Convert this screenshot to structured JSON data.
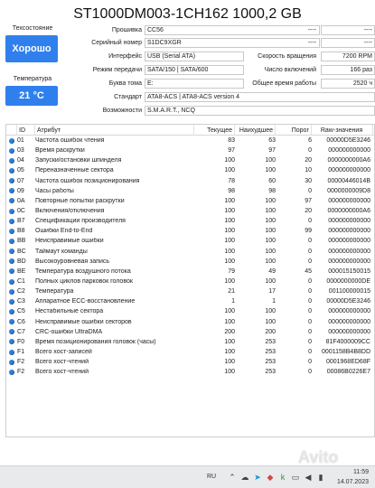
{
  "window": {
    "title": "ST1000DM003-1CH162 1000,2 GB"
  },
  "health": {
    "label": "Техсостояние",
    "value": "Хорошо",
    "color": "#2f80ed"
  },
  "temperature": {
    "label": "Температура",
    "value": "21 °C"
  },
  "info": {
    "firmware_label": "Прошивка",
    "firmware": "CC56",
    "serial_label": "Серийный номер",
    "serial": "S1DC9XGR",
    "interface_label": "Интерфейс",
    "interface": "USB (Serial ATA)",
    "transfer_label": "Режим передачи",
    "transfer": "SATA/150 | SATA/600",
    "volume_label": "Буква тома",
    "volume": "E:",
    "standard_label": "Стандарт",
    "standard": "ATA8-ACS | ATA8-ACS version 4",
    "features_label": "Возможности",
    "features": "S.M.A.R.T., NCQ"
  },
  "right": {
    "blank1": "----",
    "blank1b": "----",
    "blank2": "----",
    "blank2b": "----",
    "rpm_label": "Скорость вращения",
    "rpm": "7200 RPM",
    "power_count_label": "Число включений",
    "power_count": "166 раз",
    "power_hours_label": "Общее время работы",
    "power_hours": "2520 ч"
  },
  "table": {
    "headers": {
      "id": "ID",
      "attr": "Атрибут",
      "current": "Текущее",
      "worst": "Наихудшее",
      "threshold": "Порог",
      "raw": "Raw-значения"
    },
    "rows": [
      {
        "id": "01",
        "attr": "Частота ошибок чтения",
        "cur": "83",
        "worst": "63",
        "thr": "6",
        "raw": "00000D5E3246"
      },
      {
        "id": "03",
        "attr": "Время раскрутки",
        "cur": "97",
        "worst": "97",
        "thr": "0",
        "raw": "000000000000"
      },
      {
        "id": "04",
        "attr": "Запуски/остановки шпинделя",
        "cur": "100",
        "worst": "100",
        "thr": "20",
        "raw": "0000000000A6"
      },
      {
        "id": "05",
        "attr": "Переназначенные сектора",
        "cur": "100",
        "worst": "100",
        "thr": "10",
        "raw": "000000000000"
      },
      {
        "id": "07",
        "attr": "Частота ошибок позиционирования",
        "cur": "78",
        "worst": "60",
        "thr": "30",
        "raw": "00000446014B"
      },
      {
        "id": "09",
        "attr": "Часы работы",
        "cur": "98",
        "worst": "98",
        "thr": "0",
        "raw": "0000000009D8"
      },
      {
        "id": "0A",
        "attr": "Повторные попытки раскрутки",
        "cur": "100",
        "worst": "100",
        "thr": "97",
        "raw": "000000000000"
      },
      {
        "id": "0C",
        "attr": "Включения/отключения",
        "cur": "100",
        "worst": "100",
        "thr": "20",
        "raw": "0000000000A6"
      },
      {
        "id": "B7",
        "attr": "Спецификации производителя",
        "cur": "100",
        "worst": "100",
        "thr": "0",
        "raw": "000000000000"
      },
      {
        "id": "B8",
        "attr": "Ошибки End-to-End",
        "cur": "100",
        "worst": "100",
        "thr": "99",
        "raw": "000000000000"
      },
      {
        "id": "BB",
        "attr": "Неисправимые ошибки",
        "cur": "100",
        "worst": "100",
        "thr": "0",
        "raw": "000000000000"
      },
      {
        "id": "BC",
        "attr": "Таймаут команды",
        "cur": "100",
        "worst": "100",
        "thr": "0",
        "raw": "000000000000"
      },
      {
        "id": "BD",
        "attr": "Высокоуровневая запись",
        "cur": "100",
        "worst": "100",
        "thr": "0",
        "raw": "000000000000"
      },
      {
        "id": "BE",
        "attr": "Температура воздушного потока",
        "cur": "79",
        "worst": "49",
        "thr": "45",
        "raw": "000015150015"
      },
      {
        "id": "C1",
        "attr": "Полных циклов парковок головок",
        "cur": "100",
        "worst": "100",
        "thr": "0",
        "raw": "0000000000DE"
      },
      {
        "id": "C2",
        "attr": "Температура",
        "cur": "21",
        "worst": "17",
        "thr": "0",
        "raw": "001100000015"
      },
      {
        "id": "C3",
        "attr": "Аппаратное ECC-восстановление",
        "cur": "1",
        "worst": "1",
        "thr": "0",
        "raw": "00000D5E3246"
      },
      {
        "id": "C5",
        "attr": "Нестабильные сектора",
        "cur": "100",
        "worst": "100",
        "thr": "0",
        "raw": "000000000000"
      },
      {
        "id": "C6",
        "attr": "Неисправимые ошибки секторов",
        "cur": "100",
        "worst": "100",
        "thr": "0",
        "raw": "000000000000"
      },
      {
        "id": "C7",
        "attr": "CRC-ошибки UltraDMA",
        "cur": "200",
        "worst": "200",
        "thr": "0",
        "raw": "000000000000"
      },
      {
        "id": "F0",
        "attr": "Время позиционирования головок (часы)",
        "cur": "100",
        "worst": "253",
        "thr": "0",
        "raw": "81F4000009CC"
      },
      {
        "id": "F1",
        "attr": "Всего хост-записей",
        "cur": "100",
        "worst": "253",
        "thr": "0",
        "raw": "0001158B4B8DD"
      },
      {
        "id": "F2",
        "attr": "Всего хост-чтений",
        "cur": "100",
        "worst": "253",
        "thr": "0",
        "raw": "0001968ED68F"
      },
      {
        "id": "F2",
        "attr": "Всего хост-чтений",
        "cur": "100",
        "worst": "253",
        "thr": "0",
        "raw": "00086B0226E7"
      }
    ]
  },
  "taskbar": {
    "lang": "RU",
    "time": "11:59",
    "date": "14.07.2023"
  },
  "watermark": {
    "text": "Avito"
  }
}
